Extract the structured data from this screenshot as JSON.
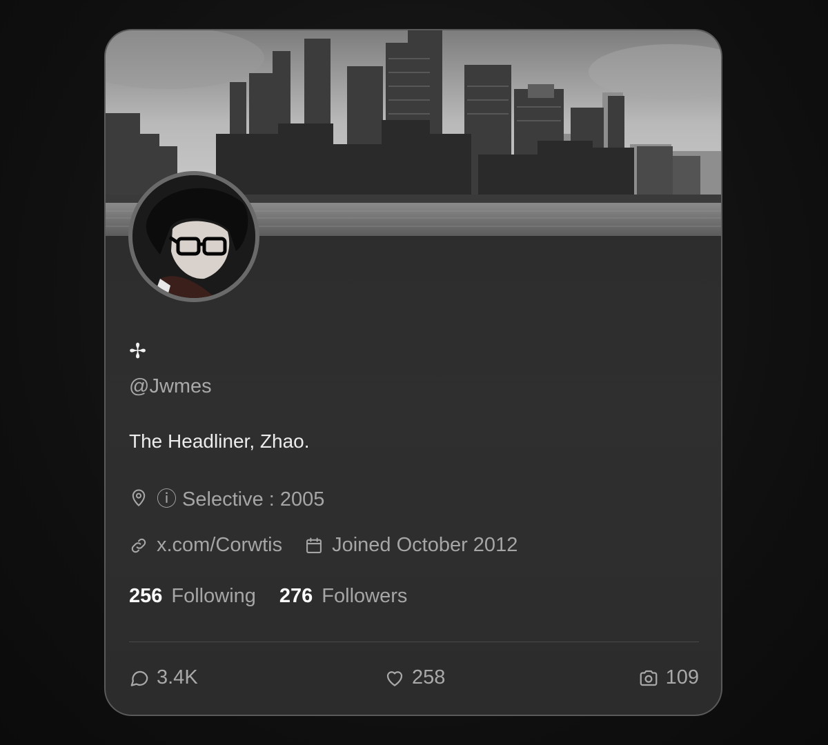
{
  "profile": {
    "display_name": "✢",
    "handle": "@Jwmes",
    "bio": "The Headliner, Zhao.",
    "location_label": "ⓘ Selective : 2005",
    "link": "x.com/Corwtis",
    "joined": "Joined October 2012"
  },
  "stats": {
    "following_count": "256",
    "following_label": "Following",
    "followers_count": "276",
    "followers_label": "Followers"
  },
  "actions": {
    "replies": "3.4K",
    "likes": "258",
    "photos": "109"
  },
  "icons": {
    "location": "map-pin-icon",
    "link": "link-icon",
    "calendar": "calendar-icon",
    "reply": "speech-bubble-icon",
    "like": "heart-icon",
    "photo": "camera-icon"
  },
  "colors": {
    "background": "#121212",
    "card": "#2c2c2c",
    "card_border": "#5a5a5a",
    "text_primary": "#f2f2f2",
    "text_secondary": "#a6a6a6"
  }
}
